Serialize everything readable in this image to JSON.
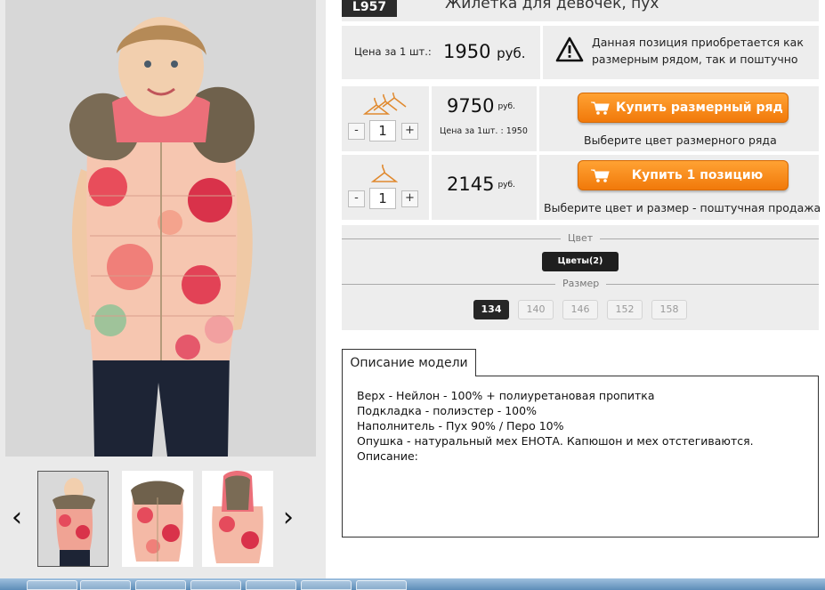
{
  "product": {
    "sku": "L957",
    "title": "Жилетка для девочек, пух"
  },
  "price_info": {
    "label": "Цена за 1 шт.:",
    "value": "1950",
    "currency": "руб.",
    "notice_line1": "Данная позиция приобретается как",
    "notice_line2": "размерным рядом, так и поштучно",
    "notice_icon": "warning-triangle-icon"
  },
  "size_row_purchase": {
    "quantity": "1",
    "minus": "-",
    "plus": "+",
    "total": "9750",
    "currency": "руб.",
    "unit_price_note": "Цена за 1шт. : 1950",
    "button_label": "Купить размерный ряд",
    "hint": "Выберите цвет размерного ряда",
    "icon": "hangers-set-icon"
  },
  "single_purchase": {
    "quantity": "1",
    "minus": "-",
    "plus": "+",
    "total": "2145",
    "currency": "руб.",
    "button_label": "Купить 1 позицию",
    "hint": "Выберите цвет и размер - поштучная продажа",
    "icon": "hanger-icon"
  },
  "selectors": {
    "color_caption": "Цвет",
    "color_option": "Цветы(2)",
    "size_caption": "Размер",
    "sizes": [
      "134",
      "140",
      "146",
      "152",
      "158"
    ],
    "selected_size": "134"
  },
  "description": {
    "tab_label": "Описание модели",
    "lines": [
      "Верх - Нейлон - 100% + полиуретановая пропитка",
      "Подкладка - полиэстер - 100%",
      "Наполнитель - Пух 90% / Перо 10%",
      "Опушка - натуральный мех ЕНОТА. Капюшон и мех отстегиваются.",
      "Описание:"
    ]
  },
  "gallery": {
    "prev": "‹",
    "next": "›",
    "thumbnail_count": 3,
    "active_thumbnail": 1
  },
  "colors": {
    "accent": "#f58a1f",
    "badge": "#2b2b2b",
    "panel": "#ededed"
  }
}
